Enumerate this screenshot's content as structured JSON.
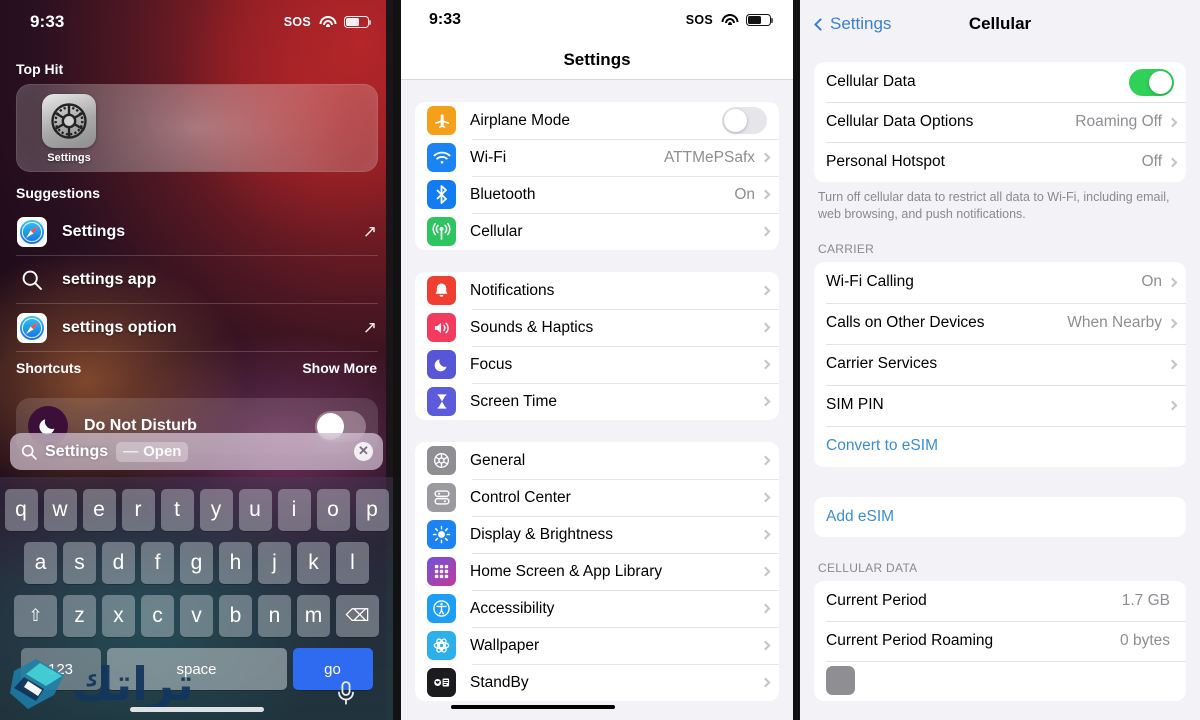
{
  "spotlight": {
    "status": {
      "time": "9:33",
      "sos": "SOS"
    },
    "top_hit_label": "Top Hit",
    "top_hit_app": "Settings",
    "suggestions_label": "Suggestions",
    "suggestions": [
      {
        "label": "Settings",
        "icon": "safari-icon",
        "action": "open-arrow"
      },
      {
        "label": "settings app",
        "icon": "search-icon",
        "action": "none"
      },
      {
        "label": "settings option",
        "icon": "safari-icon",
        "action": "open-arrow"
      }
    ],
    "shortcuts_label": "Shortcuts",
    "show_more_label": "Show More",
    "shortcut_row": {
      "label": "Do Not Disturb",
      "icon": "moon-icon",
      "toggle": "off"
    },
    "search_field": {
      "value": "Settings",
      "token_dash": "—",
      "token_action": "Open",
      "icon": "search-icon",
      "clear_icon": "clear-circle-icon"
    },
    "keyboard": {
      "row1": [
        "q",
        "w",
        "e",
        "r",
        "t",
        "y",
        "u",
        "i",
        "o",
        "p"
      ],
      "row2": [
        "a",
        "s",
        "d",
        "f",
        "g",
        "h",
        "j",
        "k",
        "l"
      ],
      "row3": [
        "z",
        "x",
        "c",
        "v",
        "b",
        "n",
        "m"
      ],
      "shift_key": "shift-icon",
      "delete_key": "delete-icon",
      "numbers_key": "123",
      "space_key": "space",
      "return_key": "go",
      "mic_key": "microphone-icon",
      "accent_color": "#2f6bf0"
    },
    "watermark": "تراتك"
  },
  "settings_list": {
    "status": {
      "time": "9:33",
      "sos": "SOS"
    },
    "title": "Settings",
    "groups": [
      {
        "rows": [
          {
            "label": "Airplane Mode",
            "icon": "airplane-icon",
            "icon_color": "#f4a01b",
            "control": "toggle-off"
          },
          {
            "label": "Wi-Fi",
            "icon": "wifi-icon",
            "icon_color": "#1b84f2",
            "value": "ATTMePSafx",
            "control": "chevron"
          },
          {
            "label": "Bluetooth",
            "icon": "bluetooth-icon",
            "icon_color": "#127cf2",
            "value": "On",
            "control": "chevron"
          },
          {
            "label": "Cellular",
            "icon": "cellular-icon",
            "icon_color": "#2ec45f",
            "value": "",
            "control": "chevron"
          }
        ]
      },
      {
        "rows": [
          {
            "label": "Notifications",
            "icon": "bell-icon",
            "icon_color": "#f03e32",
            "value": "",
            "control": "chevron"
          },
          {
            "label": "Sounds & Haptics",
            "icon": "speaker-icon",
            "icon_color": "#f43a5e",
            "value": "",
            "control": "chevron"
          },
          {
            "label": "Focus",
            "icon": "moon-icon",
            "icon_color": "#5656d6",
            "value": "",
            "control": "chevron"
          },
          {
            "label": "Screen Time",
            "icon": "hourglass-icon",
            "icon_color": "#5b5bdc",
            "value": "",
            "control": "chevron"
          }
        ]
      },
      {
        "rows": [
          {
            "label": "General",
            "icon": "gear-icon",
            "icon_color": "#8e8e93",
            "value": "",
            "control": "chevron"
          },
          {
            "label": "Control Center",
            "icon": "sliders-icon",
            "icon_color": "#9a9a9f",
            "value": "",
            "control": "chevron"
          },
          {
            "label": "Display & Brightness",
            "icon": "brightness-icon",
            "icon_color": "#1b84f2",
            "value": "",
            "control": "chevron"
          },
          {
            "label": "Home Screen & App Library",
            "icon": "grid-icon",
            "icon_color": "#8b48cf",
            "value": "",
            "control": "chevron"
          },
          {
            "label": "Accessibility",
            "icon": "accessibility-icon",
            "icon_color": "#1c9ef5",
            "value": "",
            "control": "chevron"
          },
          {
            "label": "Wallpaper",
            "icon": "wallpaper-icon",
            "icon_color": "#2bb0ea",
            "value": "",
            "control": "chevron"
          },
          {
            "label": "StandBy",
            "icon": "standby-icon",
            "icon_color": "#1c1c1e",
            "value": "",
            "control": "chevron"
          }
        ]
      }
    ]
  },
  "cellular": {
    "back_label": "Settings",
    "title": "Cellular",
    "group1": [
      {
        "label": "Cellular Data",
        "control": "toggle-on"
      },
      {
        "label": "Cellular Data Options",
        "value": "Roaming Off",
        "control": "chevron"
      },
      {
        "label": "Personal Hotspot",
        "value": "Off",
        "control": "chevron"
      }
    ],
    "footnote": "Turn off cellular data to restrict all data to Wi-Fi, including email, web browsing, and push notifications.",
    "carrier_header": "CARRIER",
    "carrier_rows": [
      {
        "label": "Wi-Fi Calling",
        "value": "On",
        "control": "chevron"
      },
      {
        "label": "Calls on Other Devices",
        "value": "When Nearby",
        "control": "chevron"
      },
      {
        "label": "Carrier Services",
        "value": "",
        "control": "chevron"
      },
      {
        "label": "SIM PIN",
        "value": "",
        "control": "chevron"
      },
      {
        "label": "Convert to eSIM",
        "value": "",
        "control": "link"
      }
    ],
    "add_esim": "Add eSIM",
    "data_header": "CELLULAR DATA",
    "data_rows": [
      {
        "label": "Current Period",
        "value": "1.7 GB"
      },
      {
        "label": "Current Period Roaming",
        "value": "0 bytes"
      }
    ],
    "accent_color": "#3b8ed6",
    "toggle_on_color": "#30d158"
  }
}
